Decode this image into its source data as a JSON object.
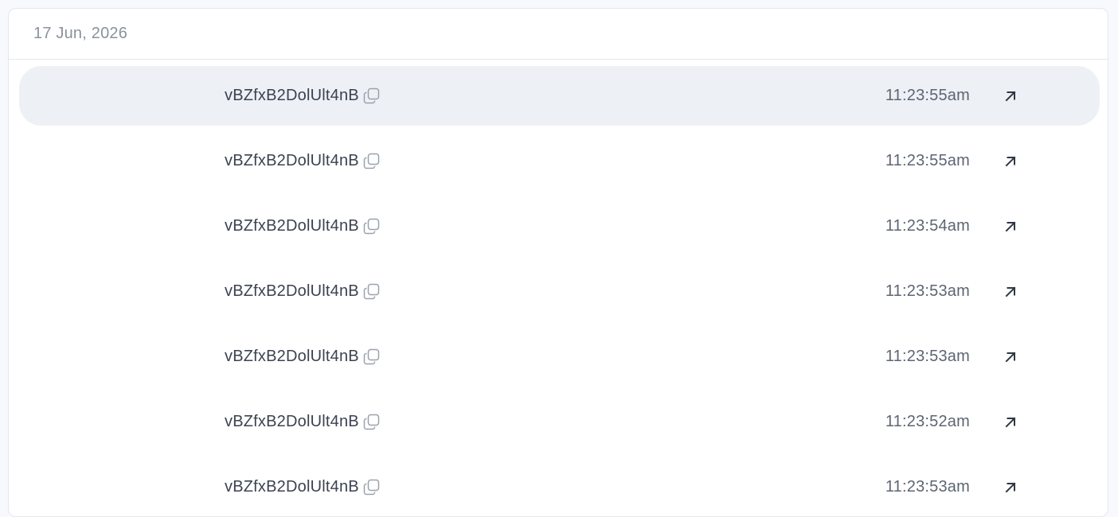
{
  "header": {
    "date": "17 Jun, 2026"
  },
  "rows": [
    {
      "id": "vBZfxB2DolUlt4nB",
      "time": "11:23:55am",
      "selected": true
    },
    {
      "id": "vBZfxB2DolUlt4nB",
      "time": "11:23:55am",
      "selected": false
    },
    {
      "id": "vBZfxB2DolUlt4nB",
      "time": "11:23:54am",
      "selected": false
    },
    {
      "id": "vBZfxB2DolUlt4nB",
      "time": "11:23:53am",
      "selected": false
    },
    {
      "id": "vBZfxB2DolUlt4nB",
      "time": "11:23:53am",
      "selected": false
    },
    {
      "id": "vBZfxB2DolUlt4nB",
      "time": "11:23:52am",
      "selected": false
    },
    {
      "id": "vBZfxB2DolUlt4nB",
      "time": "11:23:53am",
      "selected": false
    }
  ],
  "icons": {
    "copy": "copy-icon",
    "open": "arrow-up-right-icon"
  },
  "colors": {
    "selected_row_bg": "#edf1f6",
    "text_primary": "#3b4250",
    "text_muted": "#8b929b"
  }
}
